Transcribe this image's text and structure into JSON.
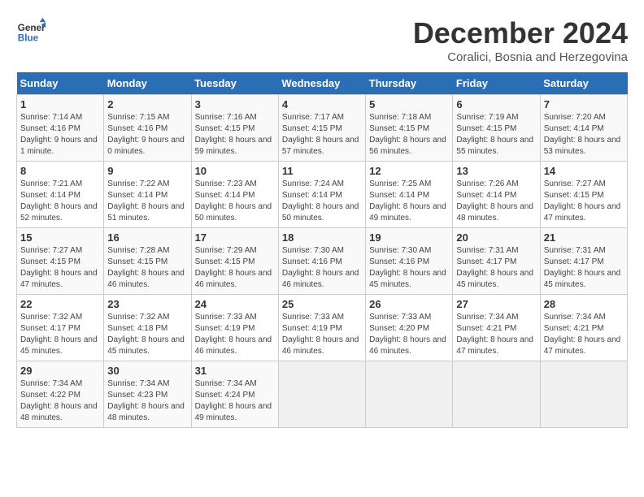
{
  "logo": {
    "text_general": "General",
    "text_blue": "Blue"
  },
  "header": {
    "month_year": "December 2024",
    "location": "Coralici, Bosnia and Herzegovina"
  },
  "columns": [
    "Sunday",
    "Monday",
    "Tuesday",
    "Wednesday",
    "Thursday",
    "Friday",
    "Saturday"
  ],
  "weeks": [
    [
      {
        "day": "1",
        "sunrise": "7:14 AM",
        "sunset": "4:16 PM",
        "daylight": "9 hours and 1 minute."
      },
      {
        "day": "2",
        "sunrise": "7:15 AM",
        "sunset": "4:16 PM",
        "daylight": "9 hours and 0 minutes."
      },
      {
        "day": "3",
        "sunrise": "7:16 AM",
        "sunset": "4:15 PM",
        "daylight": "8 hours and 59 minutes."
      },
      {
        "day": "4",
        "sunrise": "7:17 AM",
        "sunset": "4:15 PM",
        "daylight": "8 hours and 57 minutes."
      },
      {
        "day": "5",
        "sunrise": "7:18 AM",
        "sunset": "4:15 PM",
        "daylight": "8 hours and 56 minutes."
      },
      {
        "day": "6",
        "sunrise": "7:19 AM",
        "sunset": "4:15 PM",
        "daylight": "8 hours and 55 minutes."
      },
      {
        "day": "7",
        "sunrise": "7:20 AM",
        "sunset": "4:14 PM",
        "daylight": "8 hours and 53 minutes."
      }
    ],
    [
      {
        "day": "8",
        "sunrise": "7:21 AM",
        "sunset": "4:14 PM",
        "daylight": "8 hours and 52 minutes."
      },
      {
        "day": "9",
        "sunrise": "7:22 AM",
        "sunset": "4:14 PM",
        "daylight": "8 hours and 51 minutes."
      },
      {
        "day": "10",
        "sunrise": "7:23 AM",
        "sunset": "4:14 PM",
        "daylight": "8 hours and 50 minutes."
      },
      {
        "day": "11",
        "sunrise": "7:24 AM",
        "sunset": "4:14 PM",
        "daylight": "8 hours and 50 minutes."
      },
      {
        "day": "12",
        "sunrise": "7:25 AM",
        "sunset": "4:14 PM",
        "daylight": "8 hours and 49 minutes."
      },
      {
        "day": "13",
        "sunrise": "7:26 AM",
        "sunset": "4:14 PM",
        "daylight": "8 hours and 48 minutes."
      },
      {
        "day": "14",
        "sunrise": "7:27 AM",
        "sunset": "4:15 PM",
        "daylight": "8 hours and 47 minutes."
      }
    ],
    [
      {
        "day": "15",
        "sunrise": "7:27 AM",
        "sunset": "4:15 PM",
        "daylight": "8 hours and 47 minutes."
      },
      {
        "day": "16",
        "sunrise": "7:28 AM",
        "sunset": "4:15 PM",
        "daylight": "8 hours and 46 minutes."
      },
      {
        "day": "17",
        "sunrise": "7:29 AM",
        "sunset": "4:15 PM",
        "daylight": "8 hours and 46 minutes."
      },
      {
        "day": "18",
        "sunrise": "7:30 AM",
        "sunset": "4:16 PM",
        "daylight": "8 hours and 46 minutes."
      },
      {
        "day": "19",
        "sunrise": "7:30 AM",
        "sunset": "4:16 PM",
        "daylight": "8 hours and 45 minutes."
      },
      {
        "day": "20",
        "sunrise": "7:31 AM",
        "sunset": "4:17 PM",
        "daylight": "8 hours and 45 minutes."
      },
      {
        "day": "21",
        "sunrise": "7:31 AM",
        "sunset": "4:17 PM",
        "daylight": "8 hours and 45 minutes."
      }
    ],
    [
      {
        "day": "22",
        "sunrise": "7:32 AM",
        "sunset": "4:17 PM",
        "daylight": "8 hours and 45 minutes."
      },
      {
        "day": "23",
        "sunrise": "7:32 AM",
        "sunset": "4:18 PM",
        "daylight": "8 hours and 45 minutes."
      },
      {
        "day": "24",
        "sunrise": "7:33 AM",
        "sunset": "4:19 PM",
        "daylight": "8 hours and 46 minutes."
      },
      {
        "day": "25",
        "sunrise": "7:33 AM",
        "sunset": "4:19 PM",
        "daylight": "8 hours and 46 minutes."
      },
      {
        "day": "26",
        "sunrise": "7:33 AM",
        "sunset": "4:20 PM",
        "daylight": "8 hours and 46 minutes."
      },
      {
        "day": "27",
        "sunrise": "7:34 AM",
        "sunset": "4:21 PM",
        "daylight": "8 hours and 47 minutes."
      },
      {
        "day": "28",
        "sunrise": "7:34 AM",
        "sunset": "4:21 PM",
        "daylight": "8 hours and 47 minutes."
      }
    ],
    [
      {
        "day": "29",
        "sunrise": "7:34 AM",
        "sunset": "4:22 PM",
        "daylight": "8 hours and 48 minutes."
      },
      {
        "day": "30",
        "sunrise": "7:34 AM",
        "sunset": "4:23 PM",
        "daylight": "8 hours and 48 minutes."
      },
      {
        "day": "31",
        "sunrise": "7:34 AM",
        "sunset": "4:24 PM",
        "daylight": "8 hours and 49 minutes."
      },
      null,
      null,
      null,
      null
    ]
  ]
}
